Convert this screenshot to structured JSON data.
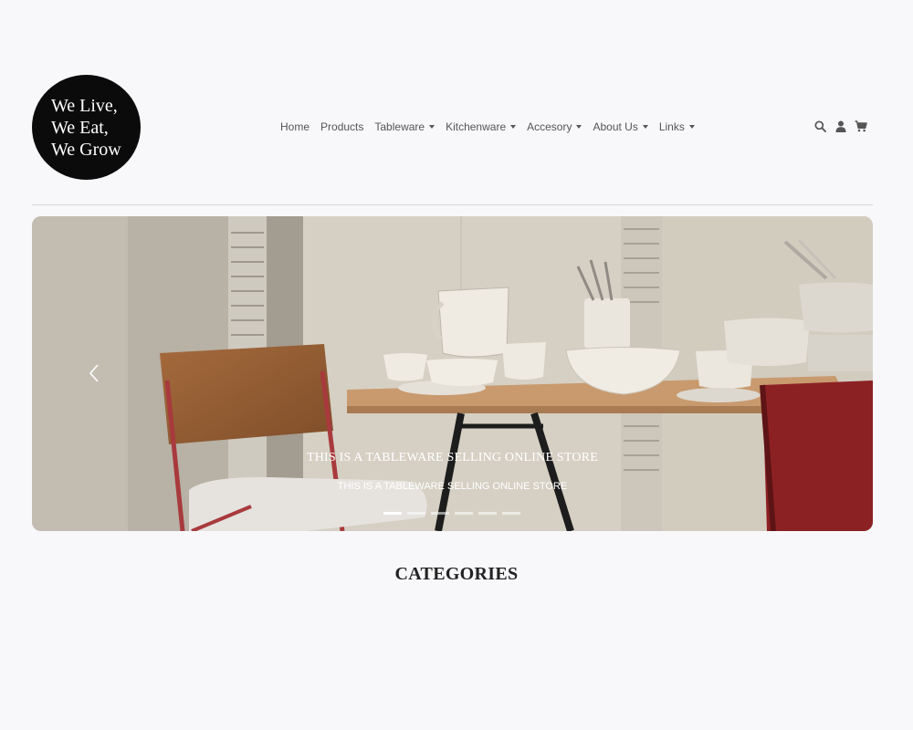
{
  "brand": {
    "logo_lines": [
      "We Live,",
      "We Eat,",
      "We Grow"
    ]
  },
  "nav": {
    "items": [
      {
        "label": "Home",
        "dropdown": false
      },
      {
        "label": "Products",
        "dropdown": false
      },
      {
        "label": "Tableware",
        "dropdown": true
      },
      {
        "label": "Kitchenware",
        "dropdown": true
      },
      {
        "label": "Accesory",
        "dropdown": true
      },
      {
        "label": "About Us",
        "dropdown": true
      },
      {
        "label": "Links",
        "dropdown": true
      }
    ]
  },
  "tools": {
    "icons": [
      "search-icon",
      "user-icon",
      "cart-icon"
    ]
  },
  "hero": {
    "title": "THIS IS A TABLEWARE SELLING ONLINE STORE",
    "subtitle": "THIS IS A TABLEWARE SELLING ONLINE STORE",
    "slide_count": 6,
    "active_slide": 1
  },
  "sections": {
    "categories_title": "CATEGORIES"
  }
}
